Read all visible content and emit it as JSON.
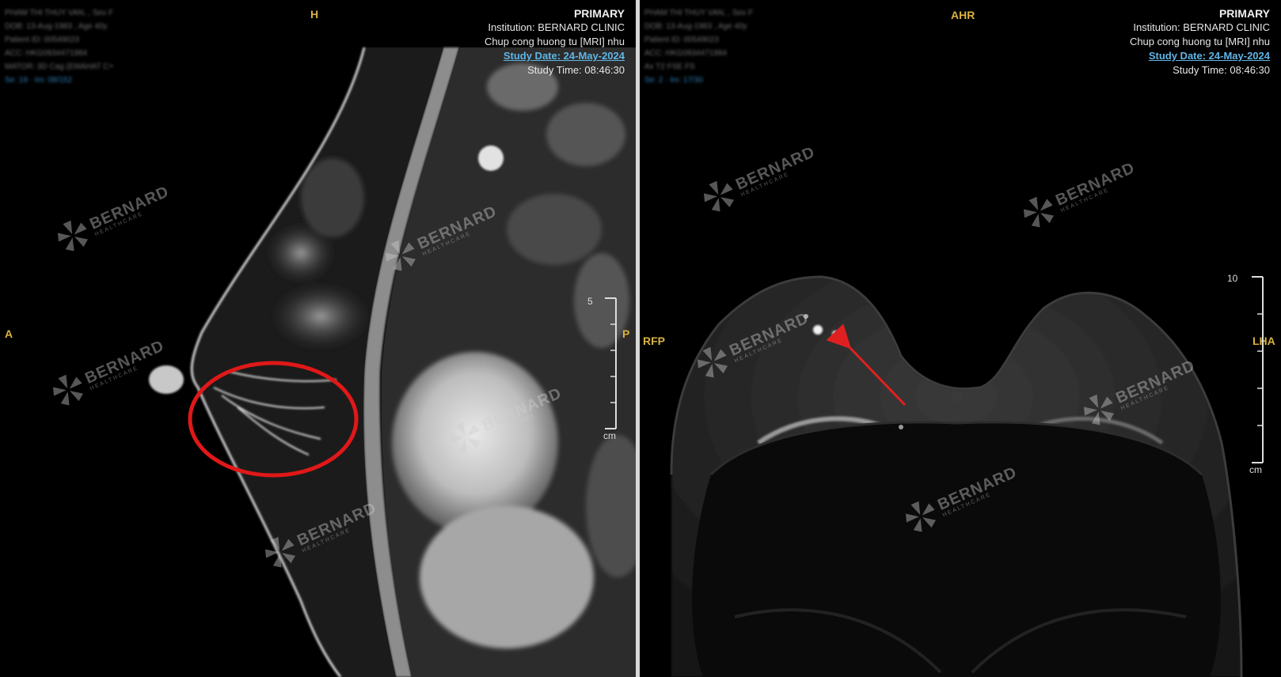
{
  "left_view": {
    "header": {
      "primary": "PRIMARY",
      "institution": "Institution: BERNARD CLINIC",
      "study_name": "Chup cong huong tu [MRI] nhu",
      "study_date": "Study Date: 24-May-2024",
      "study_time": "Study Time: 08:46:30"
    },
    "orientation": {
      "top": "H",
      "left": "A",
      "right": "P"
    },
    "scale": {
      "value": "5",
      "unit": "cm"
    },
    "patient_info_blurred": [
      "PHAM THI THUY VAN, , Sex F",
      "DOB: 13-Aug-1983 , Age 40y",
      "Patient ID: 00549023",
      "ACC: HKG0934471984",
      "MATOR: 3D Cag (EMAHAT C+",
      "Se: 19 · Im: 08/152"
    ],
    "watermark": {
      "name": "BERNARD",
      "tagline": "HEALTHCARE"
    }
  },
  "right_view": {
    "header": {
      "primary": "PRIMARY",
      "institution": "Institution: BERNARD CLINIC",
      "study_name": "Chup cong huong tu [MRI] nhu",
      "study_date": "Study Date: 24-May-2024",
      "study_time": "Study Time: 08:46:30"
    },
    "orientation": {
      "top": "AHR",
      "left": "RFP",
      "right": "LHA"
    },
    "scale": {
      "value": "10",
      "unit": "cm"
    },
    "patient_info_blurred": [
      "PHAM THI THUY VAN, , Sex F",
      "DOB: 13-Aug-1983 , Age 40y",
      "Patient ID: 00549023",
      "ACC: HKG0934471984",
      "Ax T2 FSE FS",
      "Se: 2 · Im: 17/30"
    ],
    "watermark": {
      "name": "BERNARD",
      "tagline": "HEALTHCARE"
    }
  },
  "annotations": {
    "circle_color": "#e01818",
    "arrow_color": "#e02020"
  }
}
